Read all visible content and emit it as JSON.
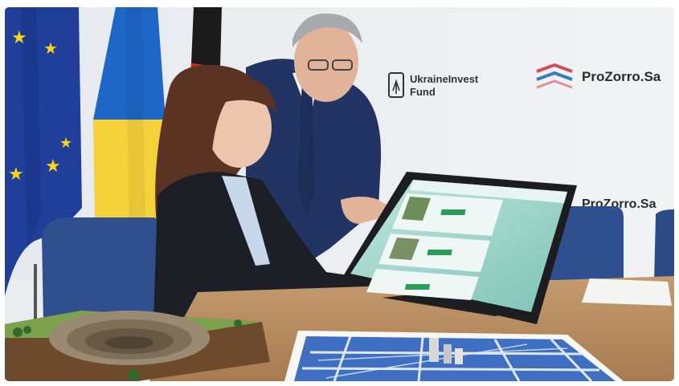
{
  "photo": {
    "background_wall": "#eceff1",
    "logos": {
      "fund_line1": "UkraineInvest",
      "fund_line2": "Fund",
      "prozorro_top": "ProZorro.Sa",
      "prozorro_bottom": "ProZorro.Sa"
    },
    "colors": {
      "eu_blue": "#1f3f9a",
      "eu_star": "#f7d21e",
      "ua_blue": "#1e66c7",
      "ua_yellow": "#f6d23a",
      "de_black": "#1b1b1b",
      "de_red": "#d6261f",
      "de_gold": "#f2c230",
      "chair_blue": "#2f4f8f",
      "table_wood": "#b98b5e",
      "screen_teal": "#8fd0c6",
      "map_blue": "#3f6fc3"
    }
  }
}
